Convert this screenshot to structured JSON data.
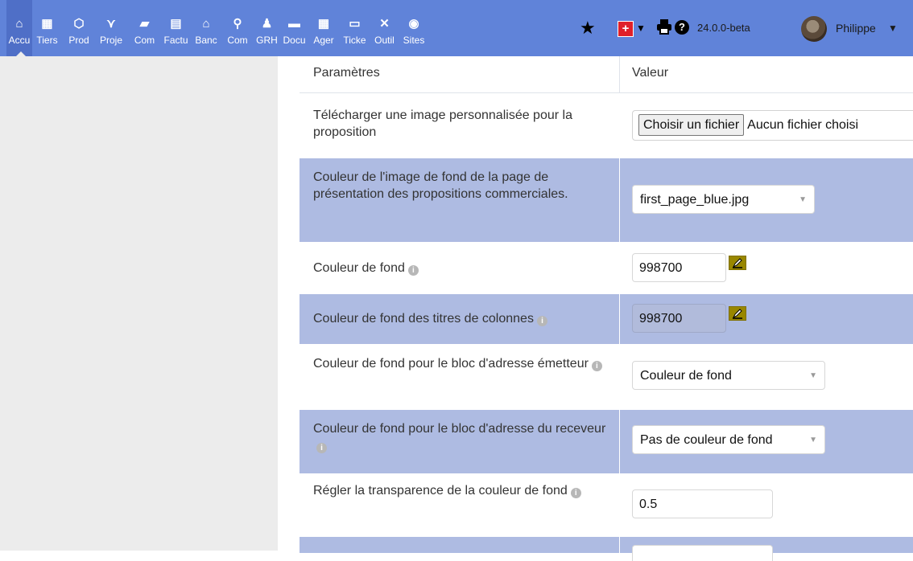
{
  "topbar": {
    "menu": [
      {
        "label": "Accu",
        "icon": "home-icon",
        "glyph": "⌂"
      },
      {
        "label": "Tiers",
        "icon": "building-icon",
        "glyph": "▦"
      },
      {
        "label": "Prod",
        "icon": "cube-icon",
        "glyph": "⬡"
      },
      {
        "label": "Proje",
        "icon": "project-icon",
        "glyph": "⋎"
      },
      {
        "label": "Com",
        "icon": "briefcase-icon",
        "glyph": "▰"
      },
      {
        "label": "Factu",
        "icon": "invoice-icon",
        "glyph": "▤"
      },
      {
        "label": "Banc",
        "icon": "bank-icon",
        "glyph": "⌂"
      },
      {
        "label": "Com",
        "icon": "search-dollar-icon",
        "glyph": "⚲"
      },
      {
        "label": "GRH",
        "icon": "users-icon",
        "glyph": "♟"
      },
      {
        "label": "Docu",
        "icon": "folder-icon",
        "glyph": "▬"
      },
      {
        "label": "Ager",
        "icon": "calendar-icon",
        "glyph": "▦"
      },
      {
        "label": "Ticke",
        "icon": "ticket-icon",
        "glyph": "▭"
      },
      {
        "label": "Outil",
        "icon": "tools-icon",
        "glyph": "✕"
      },
      {
        "label": "Sites",
        "icon": "globe-icon",
        "glyph": "◉"
      }
    ],
    "version": "24.0.0-beta",
    "user": "Philippe"
  },
  "table": {
    "header": {
      "param": "Paramètres",
      "value": "Valeur"
    },
    "rows": [
      {
        "label": "Télécharger une image personnalisée pour la proposition"
      },
      {
        "label": "Couleur de l'image de fond de la page de présentation des propositions commerciales."
      },
      {
        "label": "Couleur de fond"
      },
      {
        "label": "Couleur de fond des titres de colonnes"
      },
      {
        "label": "Couleur de fond pour le bloc d'adresse émetteur"
      },
      {
        "label": "Couleur de fond pour le bloc d'adresse du receveur"
      },
      {
        "label": "Régler la transparence de la couleur de fond"
      }
    ],
    "values": {
      "file_button": "Choisir un fichier",
      "file_status": "Aucun fichier choisi",
      "bg_image": "first_page_blue.jpg",
      "bg_color": "998700",
      "col_title_color": "998700",
      "sender_block": "Couleur de fond",
      "receiver_block": "Pas de couleur de fond",
      "transparency": "0.5"
    }
  },
  "colors": {
    "topbar": "#6083d9",
    "alt_row": "#aebbe2",
    "swatch": "#998700",
    "left_panel": "#ececec"
  }
}
